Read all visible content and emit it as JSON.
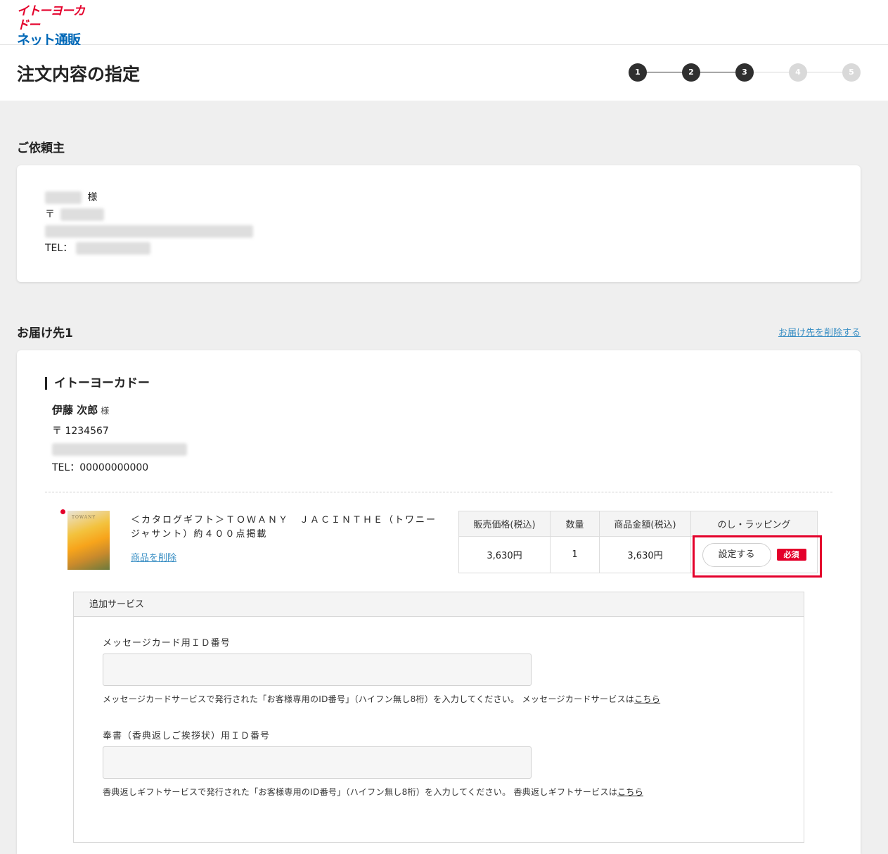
{
  "logo": {
    "line1": "イトーヨーカドー",
    "line2": "ネット通販"
  },
  "page": {
    "title": "注文内容の指定"
  },
  "steps": [
    {
      "label": "1",
      "done": true
    },
    {
      "label": "2",
      "done": true
    },
    {
      "label": "3",
      "done": true
    },
    {
      "label": "4",
      "done": false
    },
    {
      "label": "5",
      "done": false
    }
  ],
  "requester": {
    "heading": "ご依頼主",
    "sama": "様",
    "postal_prefix": "〒",
    "tel_prefix": "TEL："
  },
  "destination": {
    "heading": "お届け先1",
    "delete_link": "お届け先を削除する",
    "store_name": "イトーヨーカドー",
    "recipient_name": "伊藤 次郎",
    "sama": "様",
    "postal": "〒 1234567",
    "tel": "TEL：00000000000"
  },
  "product": {
    "thumb_label": "TOWANY",
    "name": "＜カタログギフト＞ＴＯＷＡＮＹ　ＪＡＣＩＮＴＨＥ（トワニー　ジャサント）約４００点掲載",
    "delete_link": "商品を削除",
    "table_headers": [
      "販売価格(税込)",
      "数量",
      "商品金額(税込)",
      "のし・ラッピング"
    ],
    "price": "3,630円",
    "quantity": "1",
    "subtotal": "3,630円",
    "set_button": "設定する",
    "required_badge": "必須"
  },
  "additional_services": {
    "heading": "追加サービス",
    "message_card": {
      "label": "メッセージカード用ＩＤ番号",
      "value": "",
      "help": "メッセージカードサービスで発行された「お客様専用のID番号」（ハイフン無し8桁）を入力してください。 メッセージカードサービスは",
      "link": "こちら"
    },
    "condolence": {
      "label": "奉書（香典返しご挨拶状）用ＩＤ番号",
      "value": "",
      "help": "香典返しギフトサービスで発行された「お客様専用のID番号」（ハイフン無し8桁）を入力してください。 香典返しギフトサービスは",
      "link": "こちら"
    }
  },
  "colors": {
    "accent_red": "#e4002b",
    "logo_blue": "#0068b7",
    "link_blue": "#3a8fc4"
  }
}
